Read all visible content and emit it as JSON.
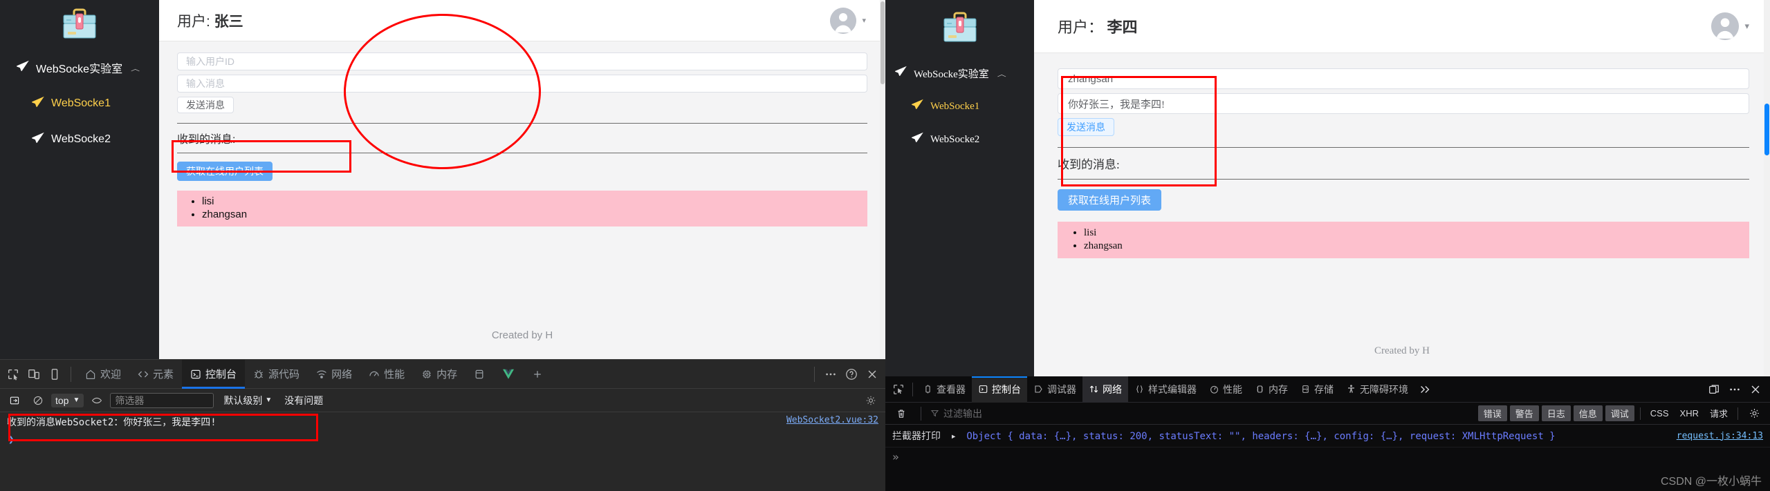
{
  "colors": {
    "sidebar_bg": "#222326",
    "accent_yellow": "#ffd04b",
    "primary_blue": "#62a9f5",
    "userlist_pink": "#fdc0cd",
    "highlight_red": "#fe0000",
    "devtools_chrome_bg": "#282828",
    "devtools_firefox_bg": "#0c0c0d",
    "chrome_tab_underline": "#1a73e8",
    "firefox_tab_underline": "#0a84ff"
  },
  "left_window": {
    "sidebar": {
      "logo_icon": "toolbox-icon",
      "root_item": {
        "icon": "paper-plane-icon",
        "label": "WebSocke实验室",
        "caret": "chevron-up-icon"
      },
      "items": [
        {
          "icon": "paper-plane-icon",
          "label": "WebSocke1",
          "active": true
        },
        {
          "icon": "paper-plane-icon",
          "label": "WebSocke2",
          "active": false
        }
      ]
    },
    "topbar": {
      "title_lead": "用户:",
      "title_value": "张三",
      "avatar_icon": "user-avatar-icon",
      "caret_icon": "chevron-down-icon"
    },
    "form": {
      "user_id_placeholder": "输入用户ID",
      "user_id_value": "",
      "message_placeholder": "输入消息",
      "message_value": "",
      "send_label": "发送消息"
    },
    "received": {
      "label": "收到的消息:",
      "fetch_button_label": "获取在线用户列表",
      "users": [
        "lisi",
        "zhangsan"
      ]
    },
    "footer": {
      "created_by": "Created by H"
    },
    "devtools": {
      "kind": "chrome",
      "left_icons": [
        "inspect-icon",
        "device-toolbar-icon",
        "device-icon"
      ],
      "tabs": [
        {
          "icon": "home-icon",
          "label": "欢迎",
          "selected": false
        },
        {
          "icon": "code-icon",
          "label": "元素",
          "selected": false
        },
        {
          "icon": "console-icon",
          "label": "控制台",
          "selected": true
        },
        {
          "icon": "bug-icon",
          "label": "源代码",
          "selected": false
        },
        {
          "icon": "network-icon",
          "label": "网络",
          "selected": false
        },
        {
          "icon": "performance-icon",
          "label": "性能",
          "selected": false
        },
        {
          "icon": "memory-icon",
          "label": "内存",
          "selected": false
        }
      ],
      "extra_tabs": [
        {
          "icon": "application-icon",
          "label": ""
        },
        {
          "icon": "vue-icon",
          "label": ""
        },
        {
          "icon": "plus-icon",
          "label": ""
        }
      ],
      "right_icons": [
        "more-icon",
        "help-icon",
        "close-icon"
      ],
      "toolbar": {
        "sidebar_toggle_icon": "console-sidebar-icon",
        "clear_icon": "clear-console-icon",
        "context_label": "top",
        "context_caret": "chevron-down-icon",
        "eye_icon": "live-expression-icon",
        "filter_placeholder": "筛选器",
        "filter_value": "",
        "level_label": "默认级别",
        "level_caret": "chevron-down-icon",
        "issues_label": "没有问题",
        "settings_icon": "gear-icon"
      },
      "console": {
        "message": "收到的消息WebSocket2：你好张三，我是李四!",
        "source_link": "WebSocket2.vue:32",
        "prompt": "❯"
      }
    }
  },
  "right_window": {
    "sidebar": {
      "logo_icon": "toolbox-icon",
      "root_item": {
        "icon": "paper-plane-icon",
        "label": "WebSocke实验室",
        "caret": "chevron-up-icon"
      },
      "items": [
        {
          "icon": "paper-plane-icon",
          "label": "WebSocke1",
          "active": true
        },
        {
          "icon": "paper-plane-icon",
          "label": "WebSocke2",
          "active": false
        }
      ]
    },
    "topbar": {
      "title_lead": "用户：",
      "title_value": "李四",
      "avatar_icon": "user-avatar-icon",
      "caret_icon": "chevron-down-icon"
    },
    "form": {
      "user_id_placeholder": "输入用户ID",
      "user_id_value": "zhangsan",
      "message_placeholder": "输入消息",
      "message_value": "你好张三，我是李四!",
      "send_label": "发送消息"
    },
    "received": {
      "label": "收到的消息:",
      "fetch_button_label": "获取在线用户列表",
      "users": [
        "lisi",
        "zhangsan"
      ]
    },
    "footer": {
      "created_by": "Created by H"
    },
    "devtools": {
      "kind": "firefox",
      "picker_icon": "element-picker-icon",
      "tabs": [
        {
          "icon": "inspector-icon",
          "label": "查看器",
          "selected": false
        },
        {
          "icon": "console-icon",
          "label": "控制台",
          "selected": true
        },
        {
          "icon": "debugger-icon",
          "label": "调试器",
          "selected": false
        },
        {
          "icon": "network-icon",
          "label": "网络",
          "selected": false,
          "hover": true
        },
        {
          "icon": "style-editor-icon",
          "label": "样式编辑器",
          "selected": false
        },
        {
          "icon": "performance-icon",
          "label": "性能",
          "selected": false
        },
        {
          "icon": "memory-icon",
          "label": "内存",
          "selected": false
        },
        {
          "icon": "storage-icon",
          "label": "存储",
          "selected": false
        },
        {
          "icon": "accessibility-icon",
          "label": "无障碍环境",
          "selected": false
        }
      ],
      "overflow_icon": "chevrons-right-icon",
      "right_icons": [
        "dock-icon",
        "more-icon",
        "close-icon"
      ],
      "toolbar": {
        "trash_icon": "trash-icon",
        "filter_icon": "funnel-icon",
        "filter_placeholder": "过滤输出",
        "filter_value": "",
        "pills": [
          "错误",
          "警告",
          "日志",
          "信息",
          "调试"
        ],
        "plain_filters": [
          "CSS",
          "XHR",
          "请求"
        ],
        "settings_icon": "gear-icon"
      },
      "console": {
        "prefix": "拦截器打印",
        "expand_icon": "disclosure-triangle-icon",
        "object_parts": [
          "Object { ",
          "data: ",
          "{…}",
          ", ",
          "status: ",
          "200",
          ", ",
          "statusText: ",
          "\"\"",
          ", ",
          "headers: ",
          "{…}",
          ", ",
          "config: ",
          "{…}",
          ", ",
          "request: ",
          "XMLHttpRequest",
          " }"
        ],
        "object_text": "Object { data: {…}, status: 200, statusText: \"\", headers: {…}, config: {…}, request: XMLHttpRequest }",
        "source_link": "request.js:34:13",
        "prompt": "»"
      },
      "watermark": "CSDN @一枚小蜗牛"
    }
  }
}
